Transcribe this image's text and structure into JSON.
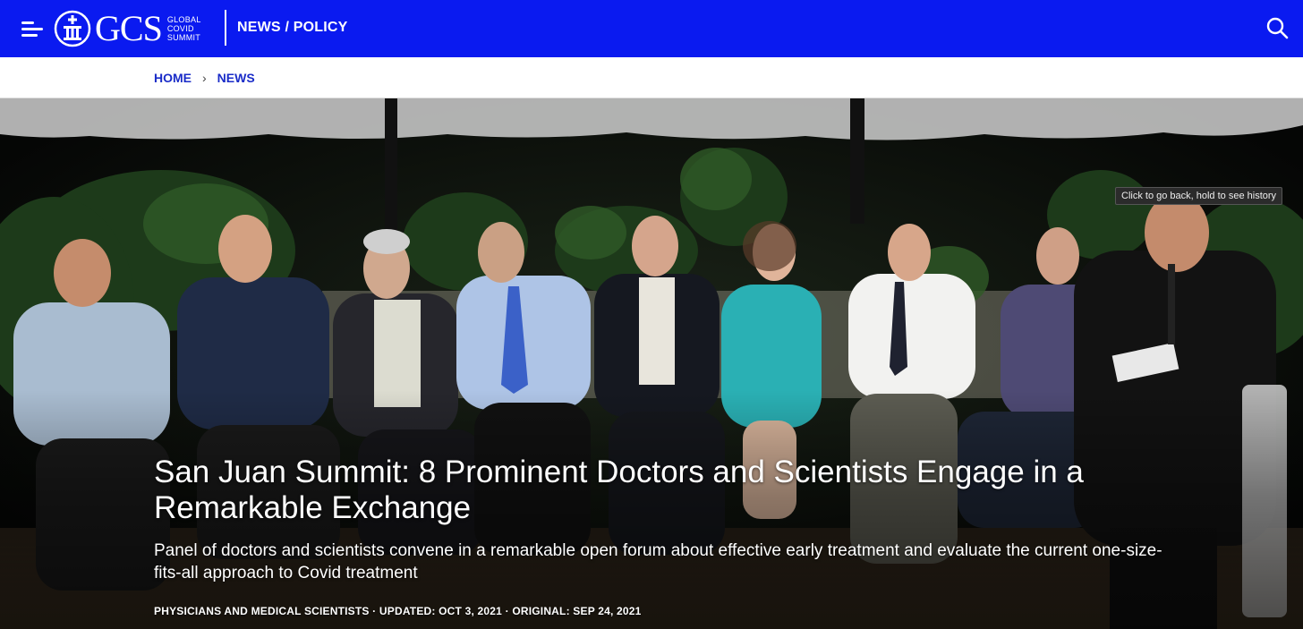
{
  "header": {
    "menu_icon": "hamburger-menu-icon",
    "logo_text": "GCS",
    "logo_sub": [
      "GLOBAL",
      "COVID",
      "SUMMIT"
    ],
    "section_title": "NEWS / POLICY",
    "search_icon": "search-icon",
    "background": "#0a1af0"
  },
  "breadcrumb": {
    "items": [
      "HOME",
      "NEWS"
    ],
    "separator": "›"
  },
  "tooltip": "Click to go back, hold to see history",
  "article": {
    "title": "San Juan Summit: 8 Prominent Doctors and Scientists Engage in a Remarkable Exchange",
    "subtitle": "Panel of doctors and scientists convene in a remarkable open forum about effective early treatment and evaluate the current one-size-fits-all approach to Covid treatment",
    "meta": {
      "category": "PHYSICIANS AND MEDICAL SCIENTISTS",
      "updated": "UPDATED: OCT 3, 2021",
      "original": "ORIGINAL: SEP 24, 2021",
      "separator": " · "
    },
    "hero_image": "panel-of-nine-people-seated-outdoors-at-night"
  }
}
